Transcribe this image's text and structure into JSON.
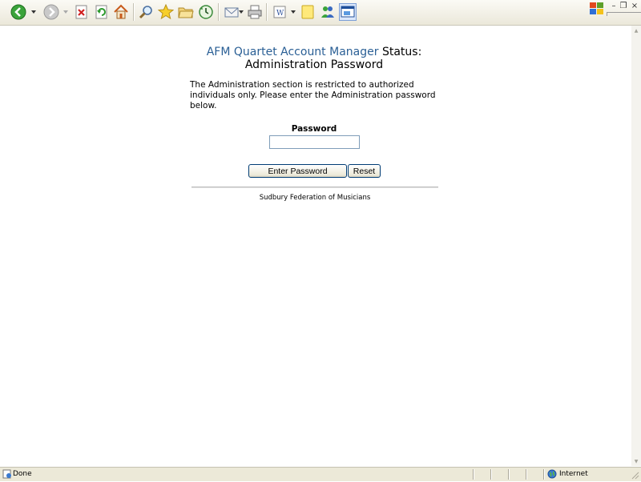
{
  "page": {
    "title_brand": "AFM Quartet Account Manager",
    "title_rest_line1": "Status:",
    "title_line2": "Administration Password",
    "description": "The Administration section is restricted to authorized individuals only. Please enter the Administration password below.",
    "password_label": "Password",
    "password_value": "",
    "enter_button": "Enter Password",
    "reset_button": "Reset",
    "footer": "Sudbury Federation of Musicians"
  },
  "statusbar": {
    "status": "Done",
    "zone": "Internet"
  },
  "colors": {
    "brand": "#2a5f95",
    "chrome": "#ece9d8"
  }
}
